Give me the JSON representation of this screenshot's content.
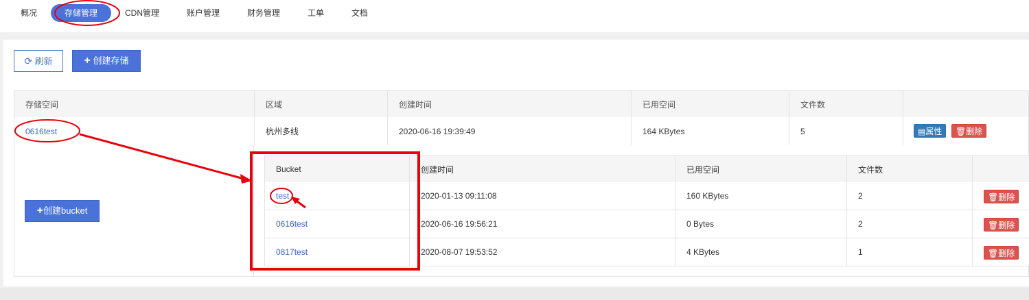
{
  "nav": {
    "items": [
      "概况",
      "存储管理",
      "CDN管理",
      "账户管理",
      "财务管理",
      "工单",
      "文档"
    ],
    "active_index": 1
  },
  "toolbar": {
    "refresh_label": "刷新",
    "create_label": "创建存储"
  },
  "storage_table": {
    "headers": [
      "存储空间",
      "区域",
      "创建时间",
      "已用空间",
      "文件数",
      ""
    ],
    "rows": [
      {
        "name": "0616test",
        "region": "杭州多线",
        "created": "2020-06-16 19:39:49",
        "used": "164 KBytes",
        "files": "5",
        "props_label": "属性",
        "delete_label": "删除"
      }
    ]
  },
  "bucket_panel": {
    "create_bucket_label": "创建bucket",
    "headers": [
      "Bucket",
      "创建时间",
      "已用空间",
      "文件数",
      ""
    ],
    "rows": [
      {
        "name": "test",
        "created": "2020-01-13 09:11:08",
        "used": "160 KBytes",
        "files": "2",
        "delete_label": "删除"
      },
      {
        "name": "0616test",
        "created": "2020-06-16 19:56:21",
        "used": "0 Bytes",
        "files": "2",
        "delete_label": "删除"
      },
      {
        "name": "0817test",
        "created": "2020-08-07 19:53:52",
        "used": "4 KBytes",
        "files": "1",
        "delete_label": "删除"
      }
    ]
  },
  "colors": {
    "primary": "#4a72d9",
    "annotation": "#e8000b",
    "danger": "#d9534f",
    "info": "#337ab7"
  }
}
